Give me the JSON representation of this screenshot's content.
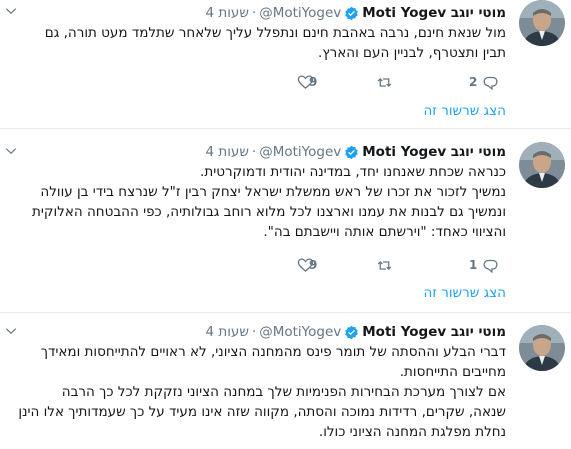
{
  "tweets": [
    {
      "name": "מוטי יוגב Moti Yogev",
      "handle": "@MotiYogev",
      "separator": "·",
      "time": "4 שעות",
      "lines": [
        "מול שנאת חינם, נרבה באהבת חינם ונתפלל עליך שלאחר שתלמד מעט תורה, גם",
        "תבין ותצטרף, לבניין העם והארץ."
      ],
      "reply_count": "2",
      "retweet_count": "",
      "like_count": "9",
      "show_thread": "הצג שרשור זה"
    },
    {
      "name": "מוטי יוגב Moti Yogev",
      "handle": "@MotiYogev",
      "separator": "·",
      "time": "4 שעות",
      "lines": [
        "כנראה שכחת שאנחנו יחד, במדינה יהודית ודמוקרטית.",
        "נמשיך לזכור את זכרו של ראש ממשלת ישראל יצחק רבין ז\"ל שנרצח בידי בן עוולה",
        "ונמשיך גם לבנות את עמנו וארצנו לכל מלוא רוחב גבולותיה, כפי ההבטחה האלוקית",
        "והציווי כאחד: \"וירשתם אותה ויישבתם בה\"."
      ],
      "reply_count": "1",
      "retweet_count": "",
      "like_count": "9",
      "show_thread": "הצג שרשור זה"
    },
    {
      "name": "מוטי יוגב Moti Yogev",
      "handle": "@MotiYogev",
      "separator": "·",
      "time": "4 שעות",
      "lines": [
        "דברי הבלע וההסתה של תומר פינס מהמחנה הציוני, לא ראויים להתייחסות ומאידך",
        "מחייבים התייחסות.",
        "אם לצורך מערכת הבחירות הפנימיות שלך במחנה הציוני נזקקת לכל כך הרבה",
        "שנאה, שקרים, רדידות נמוכה והסתה, מקווה שזה אינו מעיד על כך שעמדותיך אלו הינן",
        "נחלת מפלגת המחנה הציוני כולו."
      ]
    }
  ],
  "colors": {
    "link": "#1da1f2",
    "muted": "#657786",
    "text": "#14171a",
    "divider": "#e6ecf0"
  },
  "icons": {
    "verified": "verified-badge-icon",
    "chevron": "chevron-down-icon",
    "reply": "reply-icon",
    "retweet": "retweet-icon",
    "like": "heart-icon"
  }
}
